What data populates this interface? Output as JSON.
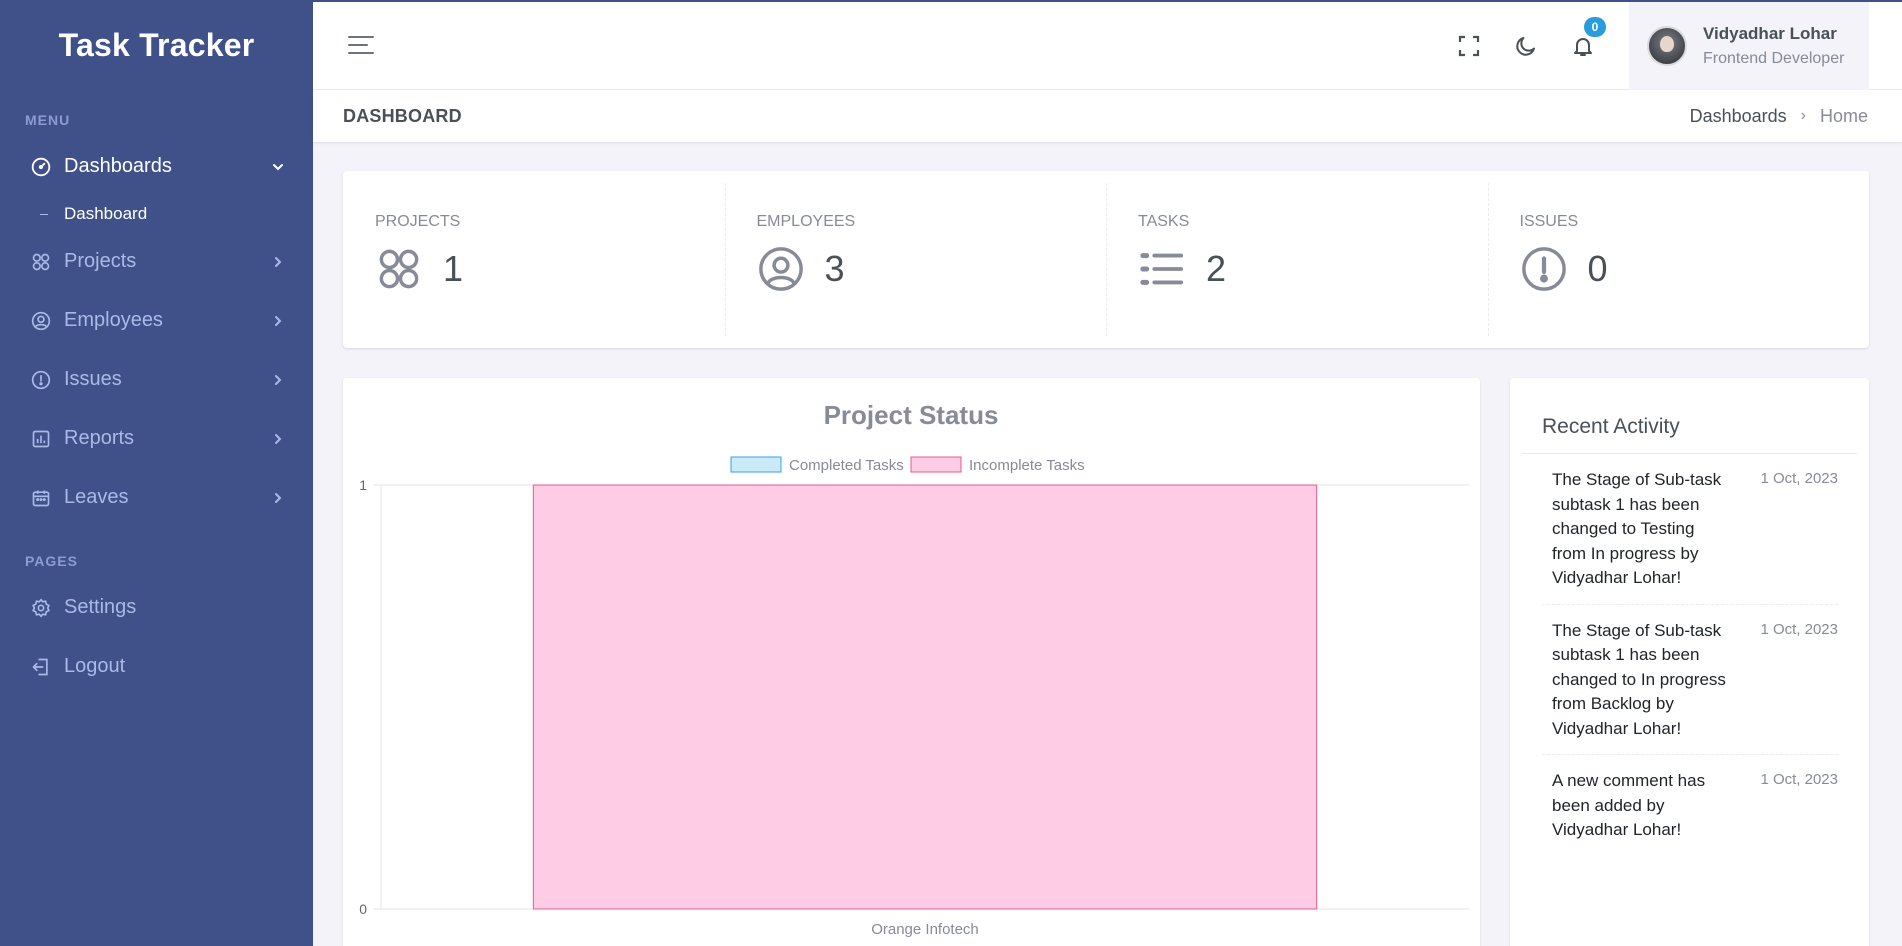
{
  "brand": "Task Tracker",
  "sidebar": {
    "menu_title": "MENU",
    "pages_title": "PAGES",
    "dashboards": "Dashboards",
    "dashboard_sub": "Dashboard",
    "projects": "Projects",
    "employees": "Employees",
    "issues": "Issues",
    "reports": "Reports",
    "leaves": "Leaves",
    "settings": "Settings",
    "logout": "Logout"
  },
  "topbar": {
    "notification_count": "0",
    "user_name": "Vidyadhar Lohar",
    "user_role": "Frontend Developer"
  },
  "page": {
    "title": "DASHBOARD",
    "crumb_1": "Dashboards",
    "crumb_2": "Home"
  },
  "stats": {
    "projects_label": "PROJECTS",
    "projects_value": "1",
    "employees_label": "EMPLOYEES",
    "employees_value": "3",
    "tasks_label": "TASKS",
    "tasks_value": "2",
    "issues_label": "ISSUES",
    "issues_value": "0"
  },
  "chart_data": {
    "type": "bar",
    "title": "Project Status",
    "categories": [
      "Orange Infotech"
    ],
    "series": [
      {
        "name": "Completed Tasks",
        "values": [
          0
        ],
        "color": "#36a2eb",
        "fill": "#cbeaf8"
      },
      {
        "name": "Incomplete Tasks",
        "values": [
          1
        ],
        "color": "#e35d8a",
        "fill": "#ffcce6"
      }
    ],
    "ylim": [
      0,
      1
    ],
    "yticks": [
      "0",
      "1"
    ],
    "legend": "top",
    "stacked": true
  },
  "activity": {
    "title": "Recent Activity",
    "items": [
      {
        "text": "The Stage of Sub-task subtask 1 has been changed to Testing from In progress by Vidyadhar Lohar!",
        "date": "1 Oct, 2023"
      },
      {
        "text": "The Stage of Sub-task subtask 1 has been changed to In progress from Backlog by Vidyadhar Lohar!",
        "date": "1 Oct, 2023"
      },
      {
        "text": "A new comment has been added by Vidyadhar Lohar!",
        "date": "1 Oct, 2023"
      }
    ]
  }
}
